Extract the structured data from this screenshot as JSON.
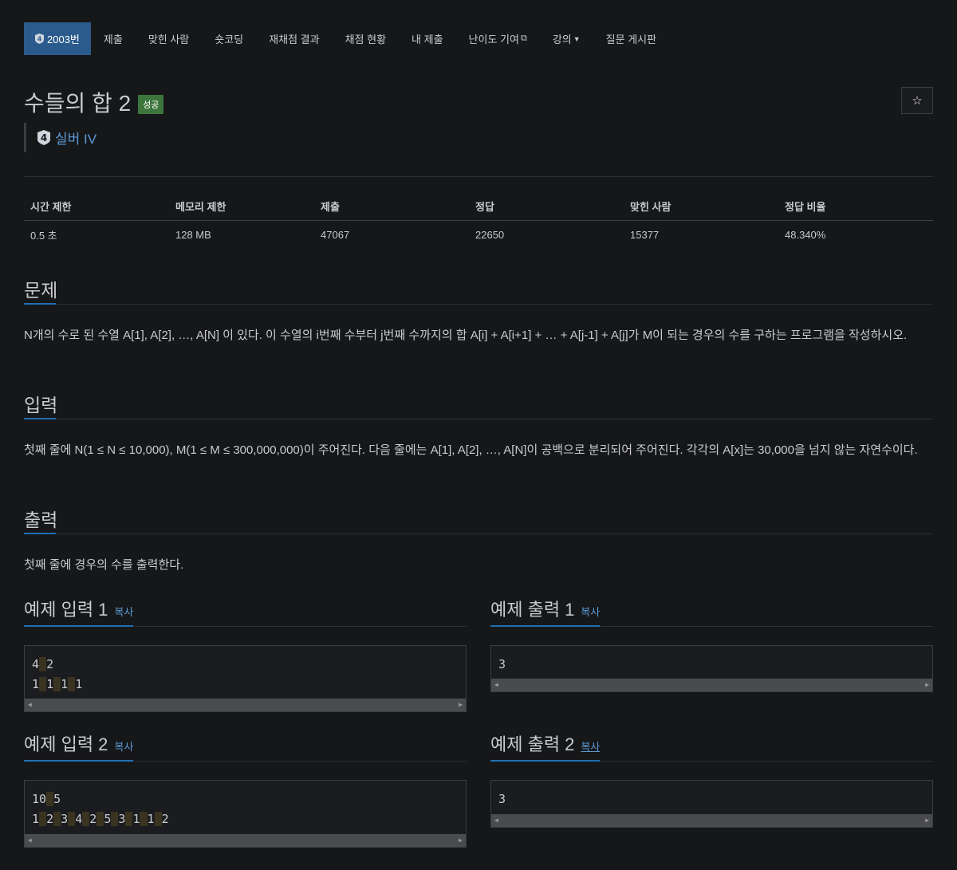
{
  "nav": {
    "items": [
      {
        "label": "2003번",
        "active": true
      },
      {
        "label": "제출"
      },
      {
        "label": "맞힌 사람"
      },
      {
        "label": "숏코딩"
      },
      {
        "label": "재채점 결과"
      },
      {
        "label": "채점 현황"
      },
      {
        "label": "내 제출"
      },
      {
        "label": "난이도 기여"
      },
      {
        "label": "강의"
      },
      {
        "label": "질문 게시판"
      }
    ]
  },
  "problem": {
    "title": "수들의 합 2",
    "badge": "성공",
    "tier_icon_number": "4",
    "tier": "실버 IV"
  },
  "info": {
    "headers": [
      "시간 제한",
      "메모리 제한",
      "제출",
      "정답",
      "맞힌 사람",
      "정답 비율"
    ],
    "values": [
      "0.5 초",
      "128 MB",
      "47067",
      "22650",
      "15377",
      "48.340%"
    ]
  },
  "sections": {
    "problem_title": "문제",
    "problem_text": "N개의 수로 된 수열 A[1], A[2], …, A[N] 이 있다. 이 수열의 i번째 수부터 j번째 수까지의 합 A[i] + A[i+1] + … + A[j-1] + A[j]가 M이 되는 경우의 수를 구하는 프로그램을 작성하시오.",
    "input_title": "입력",
    "input_text": "첫째 줄에 N(1 ≤ N ≤ 10,000), M(1 ≤ M ≤ 300,000,000)이 주어진다. 다음 줄에는 A[1], A[2], …, A[N]이 공백으로 분리되어 주어진다. 각각의 A[x]는 30,000을 넘지 않는 자연수이다.",
    "output_title": "출력",
    "output_text": "첫째 줄에 경우의 수를 출력한다."
  },
  "samples": {
    "copy_label": "복사",
    "in1_title": "예제 입력 1",
    "in1_lines": [
      [
        "4",
        "2"
      ],
      [
        "1",
        "1",
        "1",
        "1"
      ]
    ],
    "out1_title": "예제 출력 1",
    "out1_text": "3",
    "in2_title": "예제 입력 2",
    "in2_lines": [
      [
        "10",
        "5"
      ],
      [
        "1",
        "2",
        "3",
        "4",
        "2",
        "5",
        "3",
        "1",
        "1",
        "2"
      ]
    ],
    "out2_title": "예제 출력 2",
    "out2_text": "3"
  },
  "colors": {
    "background": "#161719",
    "accent": "#1f6fb3",
    "nav_active": "#2a5b8c",
    "success_badge": "#3c763d",
    "tier_text": "#5b9bd5"
  }
}
